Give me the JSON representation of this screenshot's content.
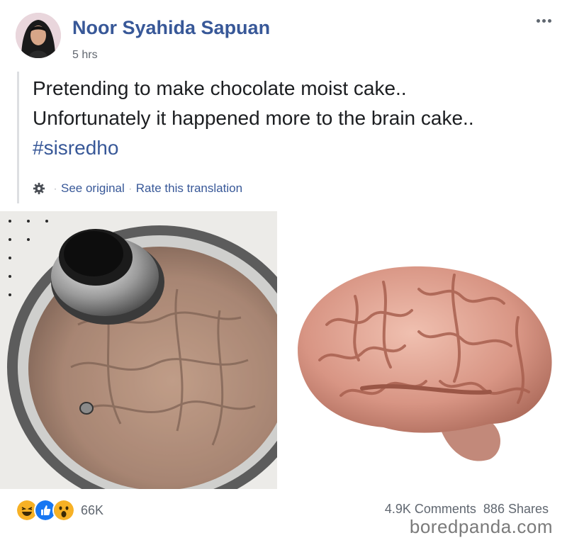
{
  "post": {
    "author": "Noor Syahida Sapuan",
    "timestamp": "5 hrs",
    "text_lines": [
      "Pretending to make chocolate moist cake..",
      "Unfortunately it happened more to the brain cake.."
    ],
    "hashtag": "#sisredho",
    "translation": {
      "see_original": "See original",
      "rate": "Rate this translation",
      "icon": "gear-icon"
    }
  },
  "images": {
    "left": "cake-in-pan-photo",
    "right": "brain-model-photo"
  },
  "footer": {
    "reaction_icons": [
      "laughing-face-icon",
      "like-icon",
      "wow-face-icon"
    ],
    "reaction_count": "66K",
    "comments": "4.9K Comments",
    "shares": "886 Shares"
  },
  "watermark": "boredpanda.com",
  "colors": {
    "link_blue": "#385898",
    "text": "#1c1e21",
    "meta": "#616770"
  }
}
